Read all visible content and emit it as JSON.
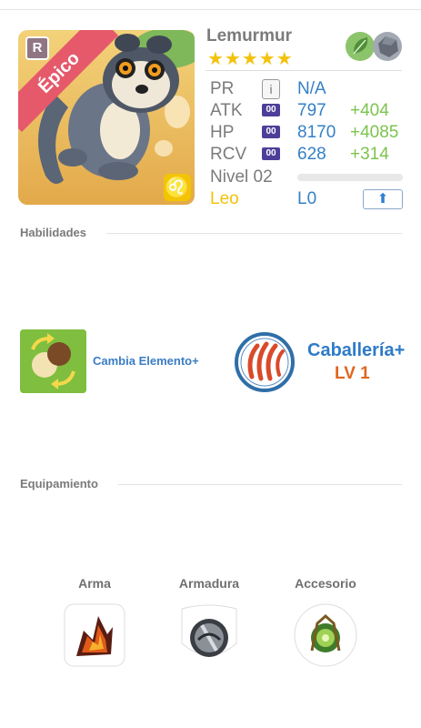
{
  "monster": {
    "name": "Lemurmur",
    "stars": "★★★★★",
    "rarity": "Épico",
    "rank_badge": "R",
    "zodiac_symbol": "♌",
    "elements": [
      "leaf-element-icon",
      "rock-element-icon"
    ]
  },
  "stats": {
    "pr": {
      "label": "PR",
      "value": "N/A",
      "icon": "i"
    },
    "atk": {
      "label": "ATK",
      "badge": "00",
      "value": "797",
      "bonus": "+404"
    },
    "hp": {
      "label": "HP",
      "badge": "00",
      "value": "8170",
      "bonus": "+4085"
    },
    "rcv": {
      "label": "RCV",
      "badge": "00",
      "value": "628",
      "bonus": "+314"
    },
    "level": {
      "label": "Nivel 02",
      "progress": 0
    },
    "zodiac": {
      "label": "Leo",
      "value": "L0",
      "share_icon": "⬆"
    }
  },
  "skills": {
    "section_title": "Habilidades",
    "active": {
      "name": "Cambia Elemento+"
    },
    "leader": {
      "name": "Caballería+",
      "level": "LV 1"
    }
  },
  "equipment": {
    "section_title": "Equipamiento",
    "slots": [
      {
        "label": "Arma",
        "icon": "fire-weapon-icon"
      },
      {
        "label": "Armadura",
        "icon": "shield-armor-icon"
      },
      {
        "label": "Accesorio",
        "icon": "green-orb-accessory-icon"
      }
    ]
  },
  "colors": {
    "accent_blue": "#3480c6",
    "bonus_green": "#7cc34f",
    "leader_orange": "#e0661e",
    "rarity_pink": "#e5596b",
    "zodiac_yellow": "#f2c20a"
  }
}
